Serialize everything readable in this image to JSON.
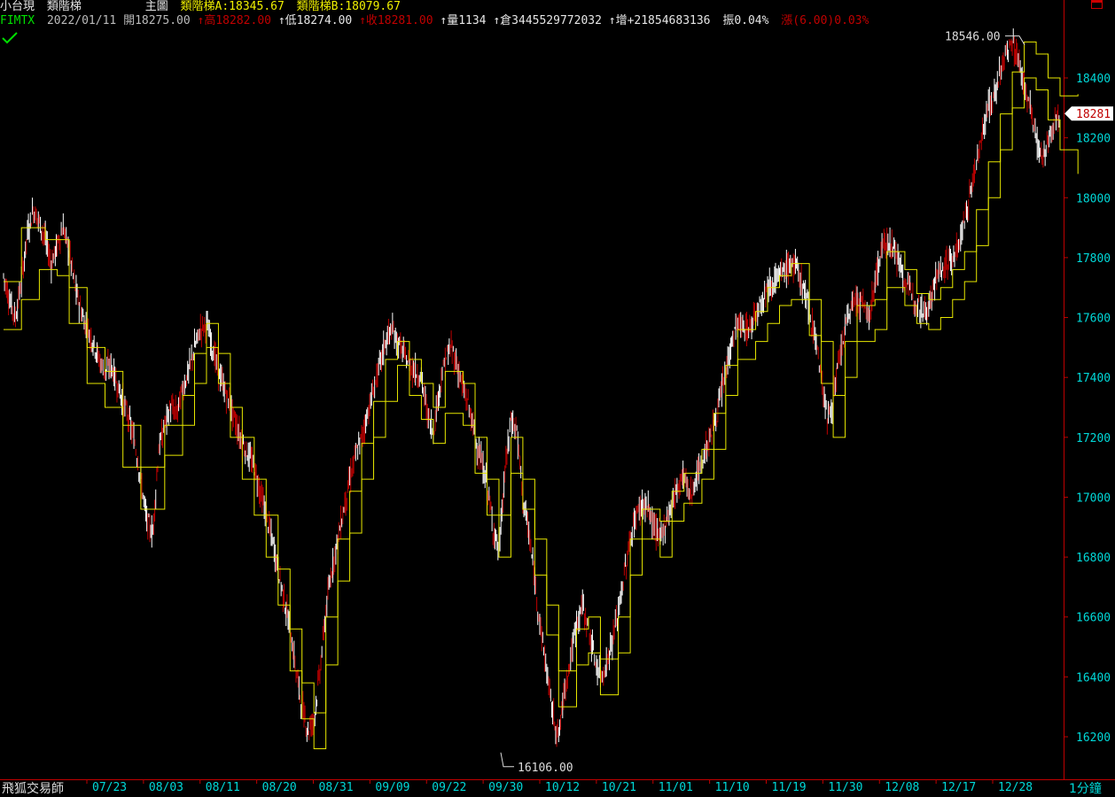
{
  "header": {
    "instrument": "小台現",
    "indicator": "類階梯",
    "view": "主圖",
    "ind_a": "類階梯A:18345.67",
    "ind_b": "類階梯B:18079.67",
    "symbol": "FIMTX",
    "date": "2022/01/11",
    "open": "開18275.00",
    "high": "高18282.00",
    "low": "低18274.00",
    "close": "收18281.00",
    "volume": "量1134",
    "oi": "倉3445529772032",
    "oi_change": "增+21854683136",
    "amplitude": "振0.04%",
    "change": "漲(6.00)0.03%"
  },
  "footer": {
    "app_name": "飛狐交易師",
    "period": "1分鐘"
  },
  "colors": {
    "background": "#000000",
    "axis": "#c00000",
    "price_label": "#00d8d8",
    "step_line": "#e8e800",
    "candle_up": "#ffffff",
    "candle_down": "#c00000"
  },
  "chart_data": {
    "type": "line",
    "y_ticks": [
      "18400",
      "18200",
      "18000",
      "17800",
      "17600",
      "17400",
      "17200",
      "17000",
      "16800",
      "16600",
      "16400",
      "16200"
    ],
    "y_tick_values": [
      18400,
      18200,
      18000,
      17800,
      17600,
      17400,
      17200,
      17000,
      16800,
      16600,
      16400,
      16200
    ],
    "ylim": [
      16060,
      18640
    ],
    "x_ticks": [
      "07/23",
      "08/03",
      "08/11",
      "08/20",
      "08/31",
      "09/09",
      "09/22",
      "09/30",
      "10/12",
      "10/21",
      "11/01",
      "11/10",
      "11/19",
      "11/30",
      "12/08",
      "12/17",
      "12/28"
    ],
    "last_price": "18281",
    "last_price_value": 18281,
    "max_label": "18546.00",
    "max_value": 18546,
    "min_label": "16106.00",
    "min_value": 16106,
    "price_series": {
      "name": "",
      "values": [
        17740,
        17660,
        17600,
        17720,
        17880,
        17960,
        17920,
        17860,
        17780,
        17840,
        17900,
        17820,
        17700,
        17620,
        17560,
        17520,
        17460,
        17420,
        17440,
        17380,
        17320,
        17260,
        17180,
        17060,
        16920,
        16880,
        17160,
        17240,
        17300,
        17280,
        17360,
        17420,
        17500,
        17560,
        17580,
        17500,
        17420,
        17360,
        17300,
        17240,
        17180,
        17140,
        17100,
        17020,
        16940,
        16860,
        16760,
        16660,
        16560,
        16420,
        16300,
        16220,
        16260,
        16420,
        16620,
        16760,
        16860,
        16960,
        17060,
        17140,
        17200,
        17280,
        17360,
        17440,
        17520,
        17560,
        17520,
        17480,
        17440,
        17420,
        17400,
        17280,
        17220,
        17360,
        17460,
        17500,
        17440,
        17360,
        17300,
        17200,
        17120,
        17040,
        16900,
        16820,
        17080,
        17260,
        17220,
        17000,
        16880,
        16720,
        16560,
        16420,
        16280,
        16200,
        16360,
        16460,
        16580,
        16640,
        16560,
        16460,
        16400,
        16440,
        16520,
        16620,
        16740,
        16860,
        16940,
        16980,
        16960,
        16900,
        16860,
        16920,
        16980,
        17040,
        17080,
        17000,
        17060,
        17120,
        17180,
        17240,
        17320,
        17420,
        17520,
        17580,
        17560,
        17560,
        17620,
        17660,
        17700,
        17720,
        17740,
        17760,
        17780,
        17760,
        17700,
        17620,
        17540,
        17400,
        17260,
        17320,
        17460,
        17560,
        17640,
        17660,
        17640,
        17600,
        17720,
        17820,
        17860,
        17840,
        17780,
        17720,
        17680,
        17660,
        17620,
        17640,
        17720,
        17760,
        17780,
        17800,
        17840,
        17920,
        18020,
        18120,
        18220,
        18300,
        18340,
        18420,
        18480,
        18520,
        18460,
        18380,
        18300,
        18200,
        18120,
        18180,
        18240,
        18281
      ]
    },
    "step_a": {
      "name": "類階梯A",
      "values": [
        17720,
        17720,
        17720,
        17900,
        17900,
        17900,
        17900,
        17860,
        17860,
        17860,
        17860,
        17700,
        17700,
        17700,
        17500,
        17500,
        17500,
        17420,
        17420,
        17420,
        17240,
        17240,
        17240,
        17100,
        17100,
        17100,
        17100,
        17240,
        17240,
        17240,
        17340,
        17340,
        17480,
        17480,
        17580,
        17580,
        17480,
        17480,
        17300,
        17300,
        17200,
        17200,
        17060,
        17060,
        16940,
        16940,
        16760,
        16760,
        16560,
        16560,
        16380,
        16380,
        16280,
        16280,
        16600,
        16600,
        16860,
        16860,
        17020,
        17020,
        17180,
        17180,
        17320,
        17320,
        17460,
        17460,
        17520,
        17520,
        17460,
        17460,
        17380,
        17380,
        17300,
        17300,
        17420,
        17420,
        17420,
        17380,
        17380,
        17200,
        17200,
        17060,
        17060,
        16940,
        16940,
        17200,
        17200,
        17060,
        17060,
        16860,
        16860,
        16640,
        16640,
        16420,
        16420,
        16420,
        16560,
        16560,
        16600,
        16600,
        16460,
        16460,
        16460,
        16600,
        16600,
        16860,
        16860,
        16960,
        16960,
        16960,
        16920,
        16920,
        17020,
        17020,
        17080,
        17080,
        17080,
        17160,
        17160,
        17280,
        17280,
        17440,
        17440,
        17560,
        17560,
        17560,
        17620,
        17620,
        17700,
        17700,
        17740,
        17740,
        17780,
        17780,
        17780,
        17660,
        17660,
        17520,
        17520,
        17340,
        17340,
        17520,
        17520,
        17640,
        17640,
        17640,
        17660,
        17660,
        17820,
        17820,
        17820,
        17760,
        17760,
        17680,
        17680,
        17660,
        17660,
        17700,
        17700,
        17760,
        17760,
        17820,
        17820,
        17960,
        17960,
        18120,
        18120,
        18280,
        18280,
        18420,
        18420,
        18520,
        18520,
        18480,
        18480,
        18400,
        18400,
        18340,
        18340,
        18340,
        18345.67
      ]
    },
    "step_b": {
      "name": "類階梯B",
      "values": [
        17560,
        17560,
        17560,
        17660,
        17660,
        17660,
        17760,
        17760,
        17760,
        17740,
        17740,
        17580,
        17580,
        17580,
        17380,
        17380,
        17380,
        17300,
        17300,
        17300,
        17100,
        17100,
        17100,
        16960,
        16960,
        16960,
        16960,
        17140,
        17140,
        17140,
        17240,
        17240,
        17380,
        17380,
        17500,
        17500,
        17380,
        17380,
        17200,
        17200,
        17060,
        17060,
        16940,
        16940,
        16800,
        16800,
        16640,
        16640,
        16420,
        16420,
        16260,
        16260,
        16160,
        16160,
        16440,
        16440,
        16720,
        16720,
        16880,
        16880,
        17060,
        17060,
        17200,
        17200,
        17320,
        17320,
        17440,
        17440,
        17340,
        17340,
        17260,
        17260,
        17180,
        17180,
        17280,
        17280,
        17280,
        17240,
        17240,
        17080,
        17080,
        16940,
        16940,
        16800,
        16800,
        17080,
        17080,
        16960,
        16960,
        16740,
        16740,
        16540,
        16540,
        16300,
        16300,
        16300,
        16440,
        16440,
        16480,
        16480,
        16340,
        16340,
        16340,
        16480,
        16480,
        16740,
        16740,
        16860,
        16860,
        16860,
        16800,
        16800,
        16920,
        16920,
        16980,
        16980,
        16980,
        17060,
        17060,
        17160,
        17160,
        17340,
        17340,
        17460,
        17460,
        17460,
        17520,
        17520,
        17580,
        17580,
        17640,
        17640,
        17660,
        17660,
        17660,
        17540,
        17540,
        17380,
        17380,
        17200,
        17200,
        17400,
        17400,
        17520,
        17520,
        17520,
        17560,
        17560,
        17700,
        17700,
        17700,
        17640,
        17640,
        17580,
        17580,
        17560,
        17560,
        17600,
        17600,
        17660,
        17660,
        17720,
        17720,
        17840,
        17840,
        18000,
        18000,
        18160,
        18160,
        18300,
        18300,
        18400,
        18400,
        18360,
        18360,
        18260,
        18260,
        18160,
        18160,
        18160,
        18079.67
      ]
    }
  }
}
